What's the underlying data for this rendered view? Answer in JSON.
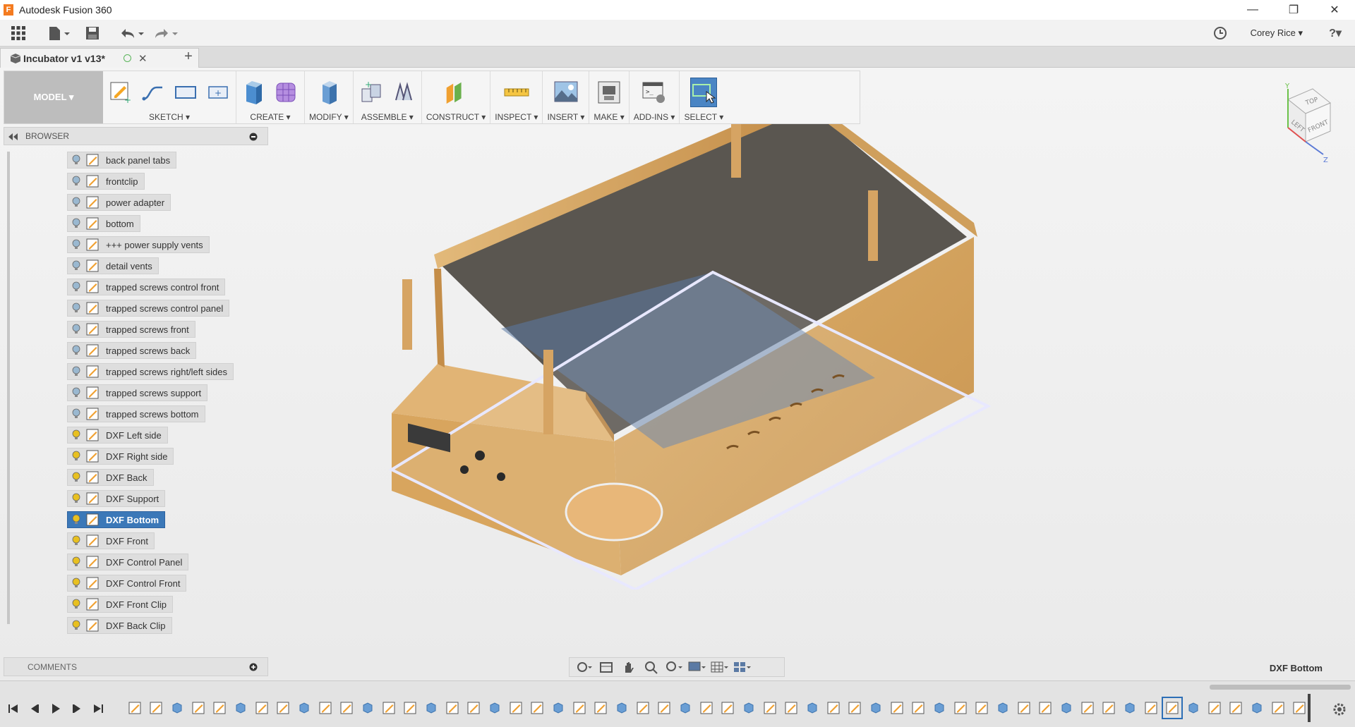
{
  "app": {
    "title": "Autodesk Fusion 360",
    "logo_letter": "F"
  },
  "window_controls": {
    "minimize": "—",
    "restore": "❐",
    "close": "✕"
  },
  "quick_access": {
    "user": "Corey Rice ▾",
    "help": "?▾"
  },
  "document_tab": {
    "name": "Incubator v1 v13*",
    "close": "✕",
    "new_tab": "+"
  },
  "toolbar": {
    "workspace_label": "MODEL ▾",
    "groups": [
      {
        "label": "SKETCH ▾"
      },
      {
        "label": "CREATE ▾"
      },
      {
        "label": "MODIFY ▾"
      },
      {
        "label": "ASSEMBLE ▾"
      },
      {
        "label": "CONSTRUCT ▾"
      },
      {
        "label": "INSPECT ▾"
      },
      {
        "label": "INSERT ▾"
      },
      {
        "label": "MAKE ▾"
      },
      {
        "label": "ADD-INS ▾"
      },
      {
        "label": "SELECT ▾"
      }
    ]
  },
  "browser": {
    "title": "BROWSER",
    "items": [
      {
        "label": "back panel tabs",
        "visible": false
      },
      {
        "label": "frontclip",
        "visible": false
      },
      {
        "label": "power adapter",
        "visible": false
      },
      {
        "label": "bottom",
        "visible": false
      },
      {
        "label": "+++ power supply vents",
        "visible": false
      },
      {
        "label": "detail vents",
        "visible": false
      },
      {
        "label": "trapped screws control front",
        "visible": false
      },
      {
        "label": "trapped screws control panel",
        "visible": false
      },
      {
        "label": "trapped screws front",
        "visible": false
      },
      {
        "label": "trapped screws back",
        "visible": false
      },
      {
        "label": "trapped screws right/left sides",
        "visible": false
      },
      {
        "label": "trapped screws support",
        "visible": false
      },
      {
        "label": "trapped screws bottom",
        "visible": false
      },
      {
        "label": "DXF Left side",
        "visible": true
      },
      {
        "label": "DXF Right side",
        "visible": true
      },
      {
        "label": "DXF Back",
        "visible": true
      },
      {
        "label": "DXF Support",
        "visible": true
      },
      {
        "label": "DXF Bottom",
        "visible": true,
        "selected": true
      },
      {
        "label": "DXF Front",
        "visible": true
      },
      {
        "label": "DXF Control Panel",
        "visible": true
      },
      {
        "label": "DXF Control Front",
        "visible": true
      },
      {
        "label": "DXF Front Clip",
        "visible": true
      },
      {
        "label": "DXF Back Clip",
        "visible": true
      }
    ]
  },
  "comments": {
    "title": "COMMENTS"
  },
  "viewcube": {
    "top": "TOP",
    "left": "LEFT",
    "front": "FRONT",
    "y": "Y",
    "z": "Z"
  },
  "status": {
    "selected_item": "DXF Bottom"
  },
  "colors": {
    "selection_blue": "#3b78b8",
    "bulb_on": "#e8c020",
    "bulb_off": "#9ab8d0",
    "wood": "#d8a55e"
  }
}
